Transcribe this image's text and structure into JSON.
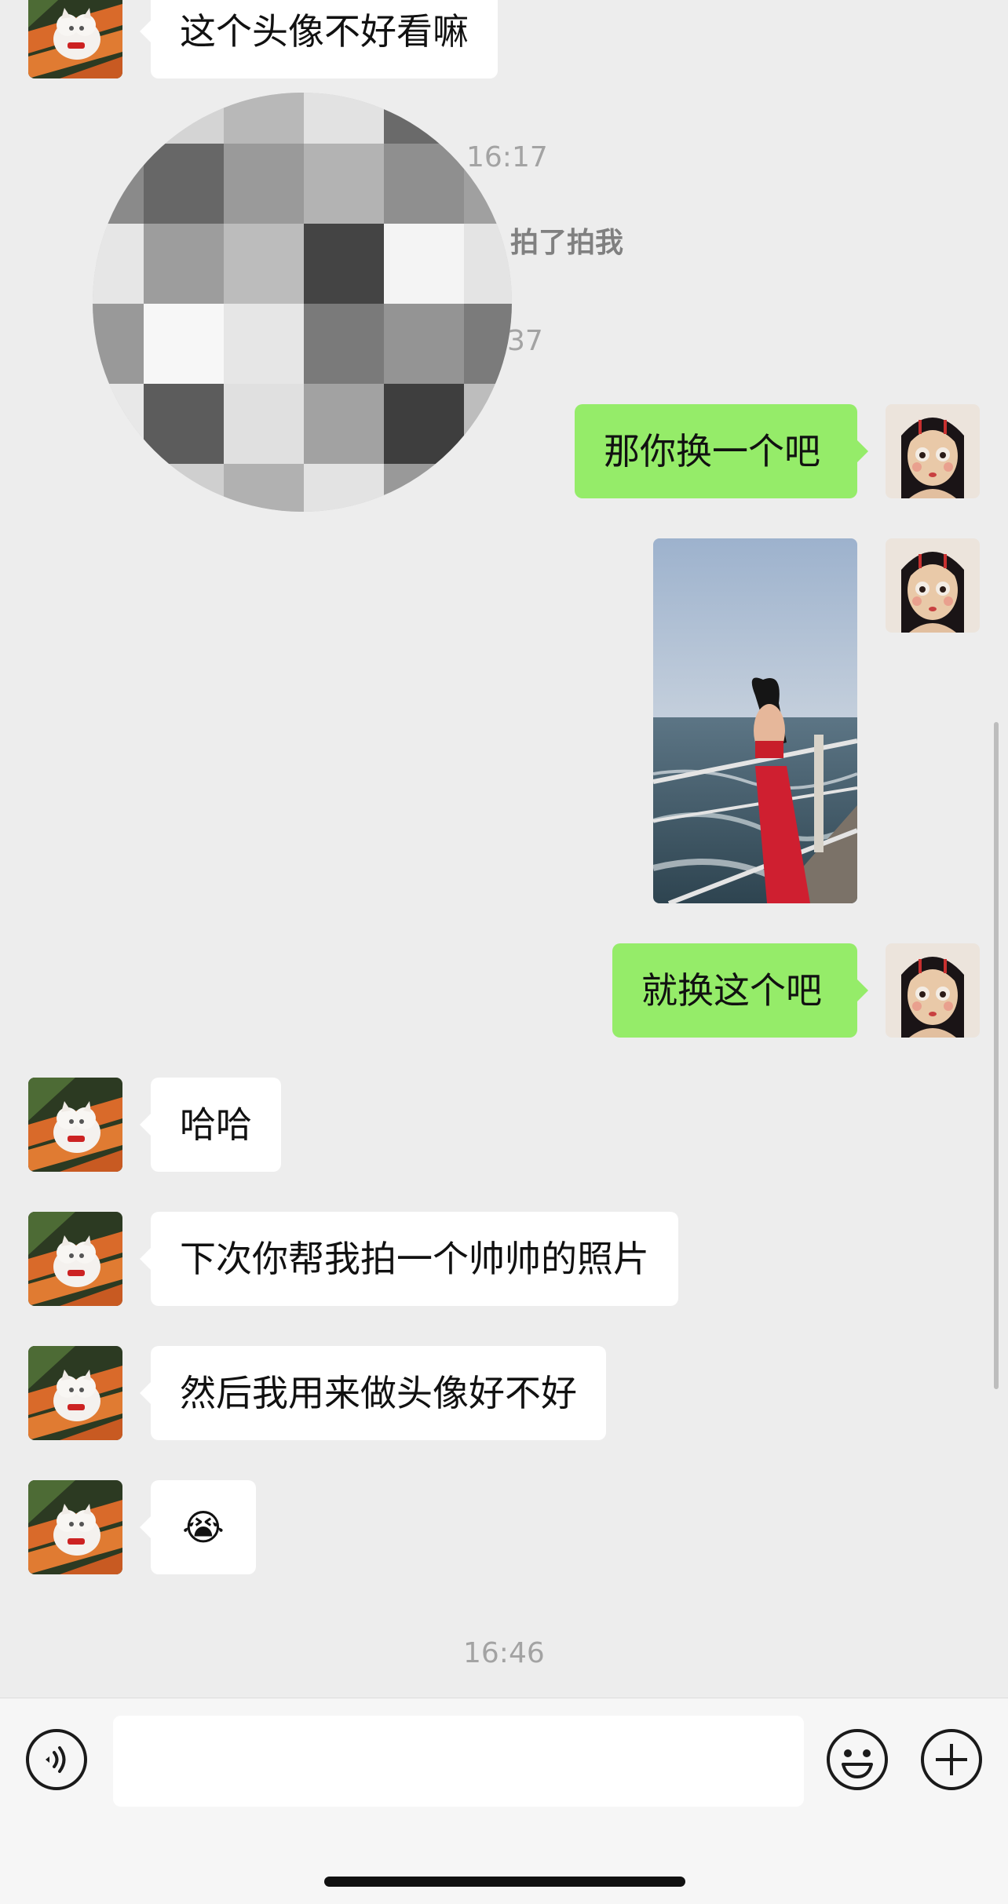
{
  "messages": {
    "m1": "这个头像不好看嘛",
    "m2": "那你换一个吧",
    "m3": "就换这个吧",
    "m4": "哈哈",
    "m5": "下次你帮我拍一个帅帅的照片",
    "m6": "然后我用来做头像好不好",
    "m7": "😭"
  },
  "system": {
    "time1": "16:17",
    "pat_text": "拍了拍我",
    "time2_fragment": "37",
    "time3": "16:46"
  },
  "input": {
    "value": ""
  },
  "icons": {
    "voice": "voice-icon",
    "emoji": "emoji-icon",
    "plus": "plus-icon"
  }
}
